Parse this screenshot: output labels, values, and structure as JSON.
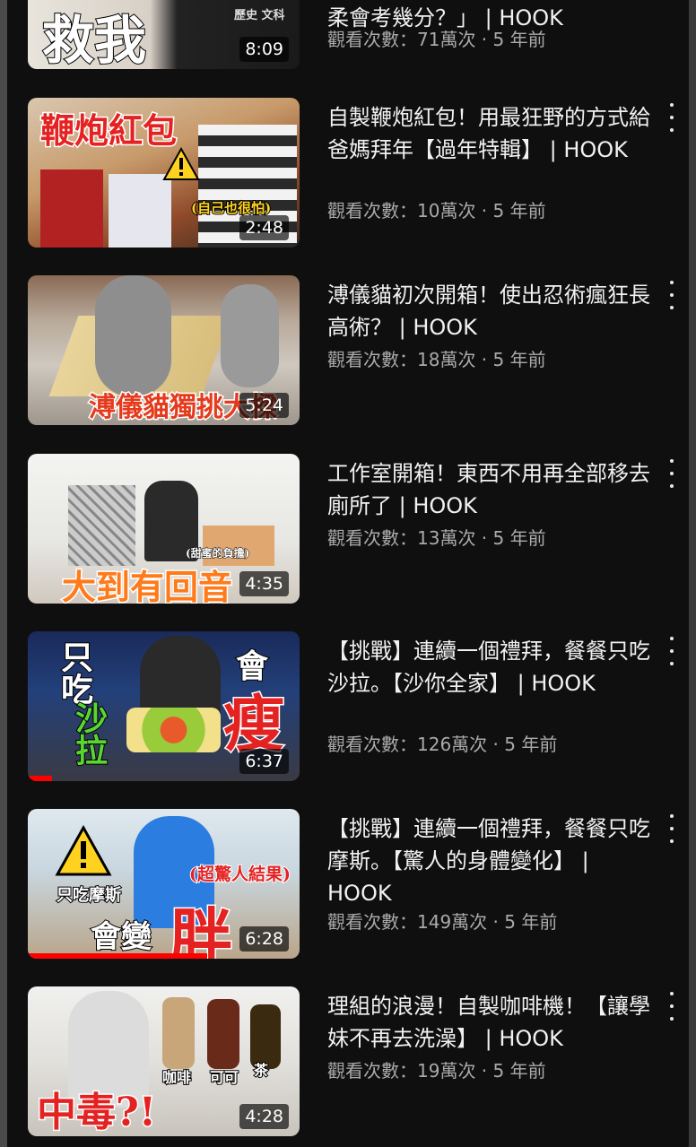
{
  "videos": [
    {
      "title": "柔會考幾分？」 | HOOK",
      "meta": "觀看次數：71萬次 · 5 年前",
      "duration": "8:09",
      "thumb_text": "救我",
      "thumb_small_text": "歷史 文科"
    },
    {
      "title": "自製鞭炮紅包！用最狂野的方式給爸媽拜年【過年特輯】 | HOOK",
      "meta": "觀看次數：10萬次 · 5 年前",
      "duration": "2:48",
      "thumb_text": "鞭炮紅包",
      "thumb_small_text": "(自己也很怕)"
    },
    {
      "title": "溥儀貓初次開箱！使出忍術瘋狂長高術？ | HOOK",
      "meta": "觀看次數：18萬次 · 5 年前",
      "duration": "5:24",
      "thumb_text": "溥儀貓獨挑大樑"
    },
    {
      "title": "工作室開箱！東西不用再全部移去廁所了 | HOOK",
      "meta": "觀看次數：13萬次 · 5 年前",
      "duration": "4:35",
      "thumb_text": "大到有回音",
      "thumb_small_text": "(甜蜜的負擔)"
    },
    {
      "title": "【挑戰】連續一個禮拜，餐餐只吃沙拉。【沙你全家】 | HOOK",
      "meta": "觀看次數：126萬次 · 5 年前",
      "duration": "6:37",
      "thumb_text_left": "只吃",
      "thumb_text_green": "沙拉",
      "thumb_text_right": "會",
      "thumb_text_big": "瘦"
    },
    {
      "title": "【挑戰】連續一個禮拜，餐餐只吃摩斯。【驚人的身體變化】 | HOOK",
      "meta": "觀看次數：149萬次 · 5 年前",
      "duration": "6:28",
      "thumb_text_left": "只吃摩斯",
      "thumb_text_mid": "會變",
      "thumb_text_big": "胖",
      "thumb_small_text": "(超驚人結果)"
    },
    {
      "title": "理組的浪漫！自製咖啡機！【讓學妹不再去洗澡】 | HOOK",
      "meta": "觀看次數：19萬次 · 5 年前",
      "duration": "4:28",
      "thumb_text": "中毒?!",
      "thumb_label_1": "咖啡",
      "thumb_label_2": "可可",
      "thumb_label_3": "茶"
    }
  ],
  "progress": {
    "video_5_watched": 0.09,
    "video_6_watched": 0.66
  },
  "colors": {
    "background": "#0f0f0f",
    "title": "#f1f1f1",
    "meta": "#aaaaaa",
    "progress": "#ff0000"
  }
}
